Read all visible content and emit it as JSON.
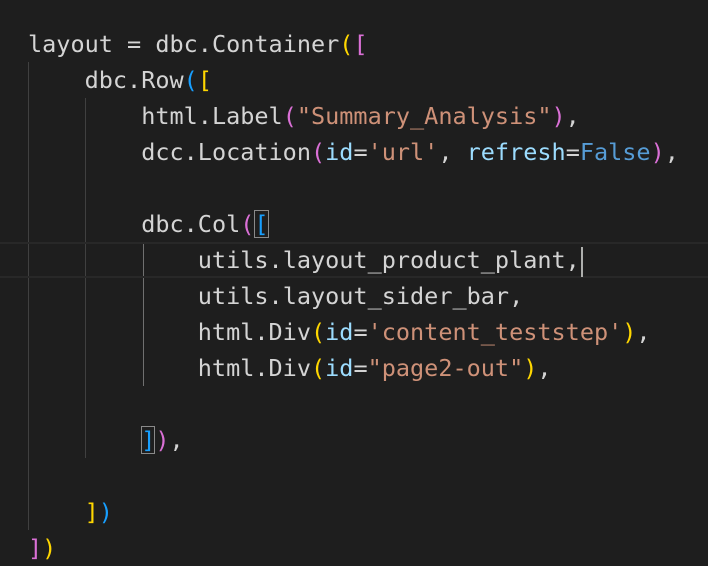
{
  "editor": {
    "lines": [
      {
        "tokens": [
          {
            "t": "layout",
            "c": "t-txt"
          },
          {
            "t": " = ",
            "c": "t-txt"
          },
          {
            "t": "dbc",
            "c": "t-txt"
          },
          {
            "t": ".",
            "c": "t-txt"
          },
          {
            "t": "Container",
            "c": "t-txt"
          },
          {
            "t": "(",
            "c": "t-b1"
          },
          {
            "t": "[",
            "c": "t-b2"
          }
        ]
      },
      {
        "tokens": [
          {
            "t": "    ",
            "c": "t-txt"
          },
          {
            "t": "dbc",
            "c": "t-txt"
          },
          {
            "t": ".",
            "c": "t-txt"
          },
          {
            "t": "Row",
            "c": "t-txt"
          },
          {
            "t": "(",
            "c": "t-b3"
          },
          {
            "t": "[",
            "c": "t-b1"
          }
        ]
      },
      {
        "tokens": [
          {
            "t": "        ",
            "c": "t-txt"
          },
          {
            "t": "html",
            "c": "t-txt"
          },
          {
            "t": ".",
            "c": "t-txt"
          },
          {
            "t": "Label",
            "c": "t-txt"
          },
          {
            "t": "(",
            "c": "t-b2"
          },
          {
            "t": "\"Summary_Analysis\"",
            "c": "t-str"
          },
          {
            "t": ")",
            "c": "t-b2"
          },
          {
            "t": ",",
            "c": "t-txt"
          }
        ]
      },
      {
        "tokens": [
          {
            "t": "        ",
            "c": "t-txt"
          },
          {
            "t": "dcc",
            "c": "t-txt"
          },
          {
            "t": ".",
            "c": "t-txt"
          },
          {
            "t": "Location",
            "c": "t-txt"
          },
          {
            "t": "(",
            "c": "t-b2"
          },
          {
            "t": "id",
            "c": "t-var"
          },
          {
            "t": "=",
            "c": "t-txt"
          },
          {
            "t": "'url'",
            "c": "t-str"
          },
          {
            "t": ", ",
            "c": "t-txt"
          },
          {
            "t": "refresh",
            "c": "t-var"
          },
          {
            "t": "=",
            "c": "t-txt"
          },
          {
            "t": "False",
            "c": "t-kw"
          },
          {
            "t": ")",
            "c": "t-b2"
          },
          {
            "t": ",",
            "c": "t-txt"
          }
        ]
      },
      {
        "tokens": []
      },
      {
        "tokens": [
          {
            "t": "        ",
            "c": "t-txt"
          },
          {
            "t": "dbc",
            "c": "t-txt"
          },
          {
            "t": ".",
            "c": "t-txt"
          },
          {
            "t": "Col",
            "c": "t-txt"
          },
          {
            "t": "(",
            "c": "t-b2"
          },
          {
            "t": "[",
            "c": "t-b3 bmatch"
          }
        ]
      },
      {
        "current": true,
        "tokens": [
          {
            "t": "            ",
            "c": "t-txt"
          },
          {
            "t": "utils",
            "c": "t-txt"
          },
          {
            "t": ".",
            "c": "t-txt"
          },
          {
            "t": "layout_product_plant",
            "c": "t-txt"
          },
          {
            "t": ",",
            "c": "t-txt"
          }
        ]
      },
      {
        "tokens": [
          {
            "t": "            ",
            "c": "t-txt"
          },
          {
            "t": "utils",
            "c": "t-txt"
          },
          {
            "t": ".",
            "c": "t-txt"
          },
          {
            "t": "layout_sider_bar",
            "c": "t-txt"
          },
          {
            "t": ",",
            "c": "t-txt"
          }
        ]
      },
      {
        "tokens": [
          {
            "t": "            ",
            "c": "t-txt"
          },
          {
            "t": "html",
            "c": "t-txt"
          },
          {
            "t": ".",
            "c": "t-txt"
          },
          {
            "t": "Div",
            "c": "t-txt"
          },
          {
            "t": "(",
            "c": "t-b1"
          },
          {
            "t": "id",
            "c": "t-var"
          },
          {
            "t": "=",
            "c": "t-txt"
          },
          {
            "t": "'content_teststep'",
            "c": "t-str"
          },
          {
            "t": ")",
            "c": "t-b1"
          },
          {
            "t": ",",
            "c": "t-txt"
          }
        ]
      },
      {
        "tokens": [
          {
            "t": "            ",
            "c": "t-txt"
          },
          {
            "t": "html",
            "c": "t-txt"
          },
          {
            "t": ".",
            "c": "t-txt"
          },
          {
            "t": "Div",
            "c": "t-txt"
          },
          {
            "t": "(",
            "c": "t-b1"
          },
          {
            "t": "id",
            "c": "t-var"
          },
          {
            "t": "=",
            "c": "t-txt"
          },
          {
            "t": "\"page2-out\"",
            "c": "t-str"
          },
          {
            "t": ")",
            "c": "t-b1"
          },
          {
            "t": ",",
            "c": "t-txt"
          }
        ]
      },
      {
        "tokens": []
      },
      {
        "tokens": [
          {
            "t": "        ",
            "c": "t-txt"
          },
          {
            "t": "]",
            "c": "t-b3 bmatch"
          },
          {
            "t": ")",
            "c": "t-b2"
          },
          {
            "t": ",",
            "c": "t-txt"
          }
        ]
      },
      {
        "tokens": []
      },
      {
        "tokens": [
          {
            "t": "    ",
            "c": "t-txt"
          },
          {
            "t": "]",
            "c": "t-b1"
          },
          {
            "t": ")",
            "c": "t-b3"
          }
        ]
      },
      {
        "tokens": [
          {
            "t": "]",
            "c": "t-b2"
          },
          {
            "t": ")",
            "c": "t-b1"
          }
        ]
      }
    ]
  }
}
